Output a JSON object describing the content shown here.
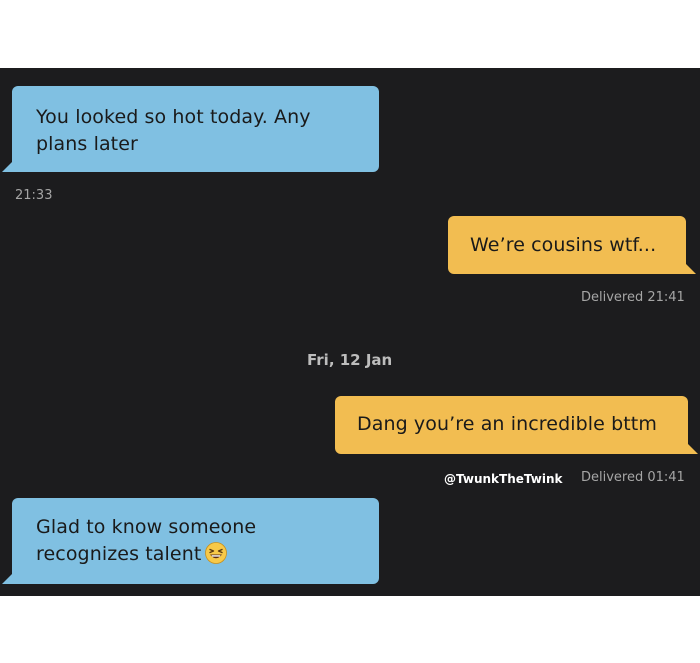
{
  "messages": [
    {
      "text": "You looked so hot today. Any plans later"
    },
    {
      "text": "We’re cousins wtf..."
    },
    {
      "text": "Dang you’re an incredible bttm"
    },
    {
      "text": "Glad to know someone recognizes talent"
    }
  ],
  "meta": {
    "time_1": "21:33",
    "delivered_1": "Delivered 21:41",
    "date_separator": "Fri, 12 Jan",
    "watermark": "@TwunkTheTwink",
    "delivered_2": "Delivered 01:41"
  },
  "icons": {
    "laughing_emoji": "grinning-squinting-face-icon"
  },
  "colors": {
    "incoming_bubble": "#80c0e2",
    "outgoing_bubble": "#f2bd51",
    "chat_background": "#1c1c1e"
  }
}
